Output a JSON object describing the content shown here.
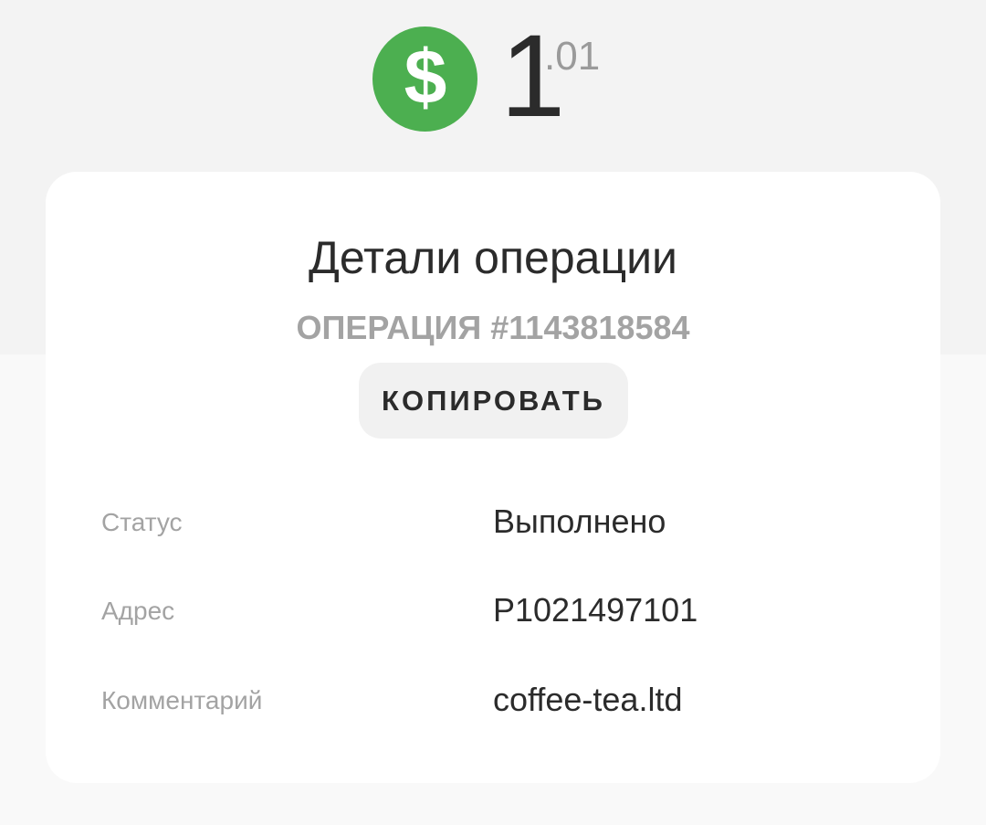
{
  "amount": {
    "icon": "dollar-icon",
    "icon_color": "#4caf50",
    "integer": "1",
    "fraction": ".01"
  },
  "details": {
    "title": "Детали операции",
    "operation_number": "ОПЕРАЦИЯ #1143818584",
    "copy_label": "КОПИРОВАТЬ",
    "rows": [
      {
        "label": "Статус",
        "value": "Выполнено"
      },
      {
        "label": "Адрес",
        "value": "P1021497101"
      },
      {
        "label": "Комментарий",
        "value": "coffee-tea.ltd"
      }
    ]
  }
}
